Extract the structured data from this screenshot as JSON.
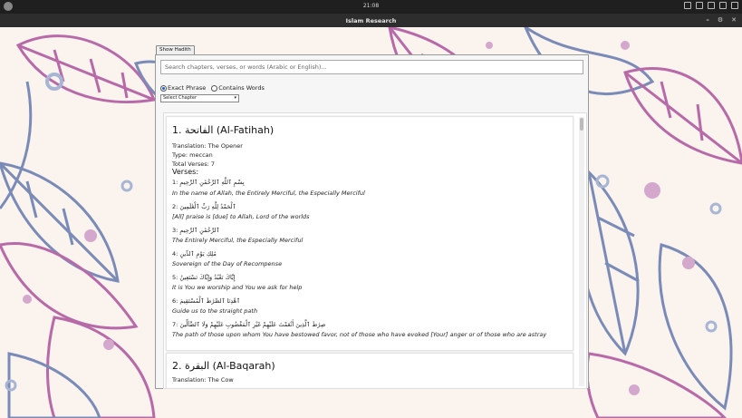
{
  "system": {
    "clock": "21:08"
  },
  "window": {
    "title": "Islam Research"
  },
  "toolbar": {
    "show_hadith_label": "Show Hadith"
  },
  "search": {
    "placeholder": "Search chapters, verses, or words (Arabic or English)..."
  },
  "options": {
    "exact_phrase": "Exact Phrase",
    "contains_words": "Contains Words",
    "selected": "exact_phrase"
  },
  "chapter_select": {
    "value": "Select Chapter"
  },
  "chapters": [
    {
      "title": "1. الفاتحة (Al-Fatihah)",
      "translation": "Translation: The Opener",
      "type": "Type: meccan",
      "total_verses": "Total Verses: 7",
      "verses_heading": "Verses:",
      "verses": [
        {
          "arabic": "1: بِسْمِ ٱللَّهِ ٱلرَّحْمَٰنِ ٱلرَّحِيمِ",
          "translation": "In the name of Allah, the Entirely Merciful, the Especially Merciful"
        },
        {
          "arabic": "2: ٱلْحَمْدُ لِلَّهِ رَبِّ ٱلْعَٰلَمِينَ",
          "translation": "[All] praise is [due] to Allah, Lord of the worlds"
        },
        {
          "arabic": "3: ٱلرَّحْمَٰنِ ٱلرَّحِيمِ",
          "translation": "The Entirely Merciful, the Especially Merciful"
        },
        {
          "arabic": "4: مَٰلِكِ يَوْمِ ٱلدِّينِ",
          "translation": "Sovereign of the Day of Recompense"
        },
        {
          "arabic": "5: إِيَّاكَ نَعْبُدُ وَإِيَّاكَ نَسْتَعِينُ",
          "translation": "It is You we worship and You we ask for help"
        },
        {
          "arabic": "6: ٱهْدِنَا ٱلصِّرَٰطَ ٱلْمُسْتَقِيمَ",
          "translation": "Guide us to the straight path"
        },
        {
          "arabic": "7: صِرَٰطَ ٱلَّذِينَ أَنْعَمْتَ عَلَيْهِمْ غَيْرِ ٱلْمَغْضُوبِ عَلَيْهِمْ وَلَا ٱلضَّآلِّينَ",
          "translation": "The path of those upon whom You have bestowed favor, not of those who have evoked [Your] anger or of those who are astray"
        }
      ]
    },
    {
      "title": "2. البقرة (Al-Baqarah)",
      "translation": "Translation: The Cow"
    }
  ]
}
